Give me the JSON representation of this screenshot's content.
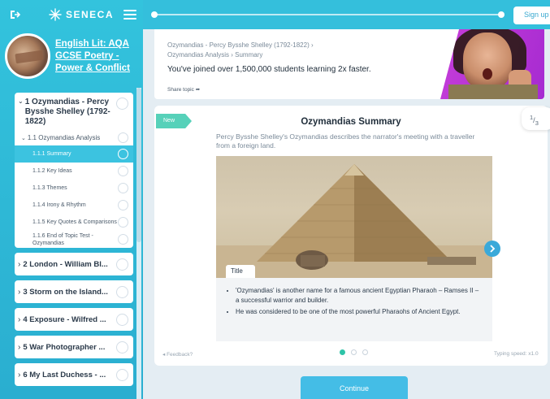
{
  "app": {
    "logo_text": "SENECA"
  },
  "sidebar": {
    "course_title": "English Lit: AQA GCSE Poetry - Power & Conflict",
    "open_topic": {
      "label": "1 Ozymandias - Percy Bysshe Shelley (1792-1822)",
      "sub": {
        "label": "1.1 Ozymandias Analysis",
        "lessons": [
          {
            "label": "1.1.1 Summary",
            "active": true
          },
          {
            "label": "1.1.2 Key Ideas",
            "active": false
          },
          {
            "label": "1.1.3 Themes",
            "active": false
          },
          {
            "label": "1.1.4 Irony & Rhythm",
            "active": false
          },
          {
            "label": "1.1.5 Key Quotes & Comparisons",
            "active": false
          },
          {
            "label": "1.1.6 End of Topic Test - Ozymandias",
            "active": false
          }
        ]
      }
    },
    "closed_topics": [
      "2 London - William Bl...",
      "3 Storm on the Island...",
      "4 Exposure - Wilfred ...",
      "5 War Photographer ...",
      "6 My Last Duchess - ..."
    ]
  },
  "topbar": {
    "signup_label": "Sign up"
  },
  "banner": {
    "breadcrumb_line1": "Ozymandias - Percy Bysshe Shelley (1792-1822) ›",
    "breadcrumb_line2": "Ozymandias Analysis › Summary",
    "headline": "You've joined over 1,500,000 students learning 2x faster.",
    "share_label": "Share topic"
  },
  "card": {
    "badge": "New",
    "title": "Ozymandias Summary",
    "description": "Percy Bysshe Shelley's Ozymandias describes the narrator's meeting with a traveller from a foreign land.",
    "page_num": "1",
    "page_total": "3",
    "image_tab_label": "Title",
    "bullets": [
      "'Ozymandias' is another name for a famous ancient Egyptian Pharaoh – Ramses II – a successful warrior and builder.",
      "He was considered to be one of the most powerful Pharaohs of Ancient Egypt."
    ],
    "feedback_label": "Feedback?",
    "typing_speed_label": "Typing speed: x1.0",
    "dots": 3,
    "active_dot": 0
  },
  "footer": {
    "continue_label": "Continue"
  },
  "colors": {
    "brand": "#34bfdc",
    "accent_green": "#56d1b9",
    "button_blue": "#44bde6"
  }
}
